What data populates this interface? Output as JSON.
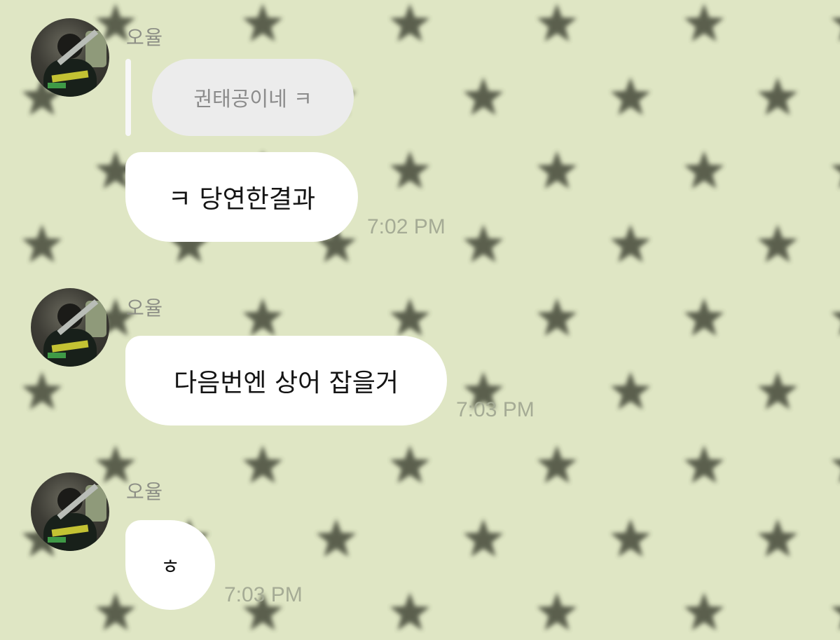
{
  "messages": [
    {
      "sender": "오율",
      "reply_quote": "권태공이네 ㅋ",
      "text": "ㅋ 당연한결과",
      "time": "7:02 PM"
    },
    {
      "sender": "오율",
      "text": "다음번엔 상어 잡을거",
      "time": "7:03 PM"
    },
    {
      "sender": "오율",
      "text": "ㅎ",
      "time": "7:03 PM"
    }
  ],
  "colors": {
    "background": "#dfe6c4",
    "star": "#4a4d3c",
    "bubble": "#ffffff",
    "quote_bubble": "#ececec",
    "timestamp": "#a5ab95",
    "sender_name": "#8d8f86"
  },
  "icons": {
    "wallpaper_pattern": "star-icon"
  }
}
